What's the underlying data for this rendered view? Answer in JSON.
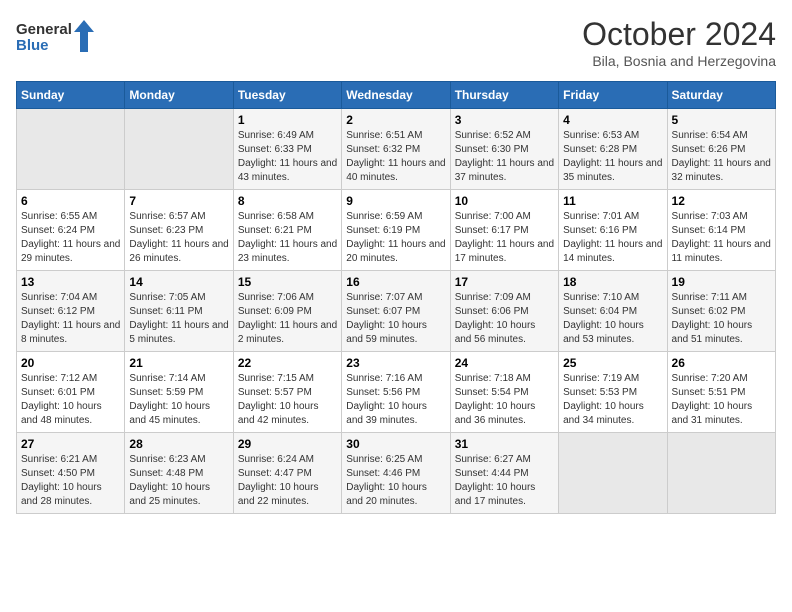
{
  "header": {
    "logo_line1": "General",
    "logo_line2": "Blue",
    "month": "October 2024",
    "location": "Bila, Bosnia and Herzegovina"
  },
  "weekdays": [
    "Sunday",
    "Monday",
    "Tuesday",
    "Wednesday",
    "Thursday",
    "Friday",
    "Saturday"
  ],
  "weeks": [
    [
      {
        "num": "",
        "info": ""
      },
      {
        "num": "",
        "info": ""
      },
      {
        "num": "1",
        "info": "Sunrise: 6:49 AM\nSunset: 6:33 PM\nDaylight: 11 hours and 43 minutes."
      },
      {
        "num": "2",
        "info": "Sunrise: 6:51 AM\nSunset: 6:32 PM\nDaylight: 11 hours and 40 minutes."
      },
      {
        "num": "3",
        "info": "Sunrise: 6:52 AM\nSunset: 6:30 PM\nDaylight: 11 hours and 37 minutes."
      },
      {
        "num": "4",
        "info": "Sunrise: 6:53 AM\nSunset: 6:28 PM\nDaylight: 11 hours and 35 minutes."
      },
      {
        "num": "5",
        "info": "Sunrise: 6:54 AM\nSunset: 6:26 PM\nDaylight: 11 hours and 32 minutes."
      }
    ],
    [
      {
        "num": "6",
        "info": "Sunrise: 6:55 AM\nSunset: 6:24 PM\nDaylight: 11 hours and 29 minutes."
      },
      {
        "num": "7",
        "info": "Sunrise: 6:57 AM\nSunset: 6:23 PM\nDaylight: 11 hours and 26 minutes."
      },
      {
        "num": "8",
        "info": "Sunrise: 6:58 AM\nSunset: 6:21 PM\nDaylight: 11 hours and 23 minutes."
      },
      {
        "num": "9",
        "info": "Sunrise: 6:59 AM\nSunset: 6:19 PM\nDaylight: 11 hours and 20 minutes."
      },
      {
        "num": "10",
        "info": "Sunrise: 7:00 AM\nSunset: 6:17 PM\nDaylight: 11 hours and 17 minutes."
      },
      {
        "num": "11",
        "info": "Sunrise: 7:01 AM\nSunset: 6:16 PM\nDaylight: 11 hours and 14 minutes."
      },
      {
        "num": "12",
        "info": "Sunrise: 7:03 AM\nSunset: 6:14 PM\nDaylight: 11 hours and 11 minutes."
      }
    ],
    [
      {
        "num": "13",
        "info": "Sunrise: 7:04 AM\nSunset: 6:12 PM\nDaylight: 11 hours and 8 minutes."
      },
      {
        "num": "14",
        "info": "Sunrise: 7:05 AM\nSunset: 6:11 PM\nDaylight: 11 hours and 5 minutes."
      },
      {
        "num": "15",
        "info": "Sunrise: 7:06 AM\nSunset: 6:09 PM\nDaylight: 11 hours and 2 minutes."
      },
      {
        "num": "16",
        "info": "Sunrise: 7:07 AM\nSunset: 6:07 PM\nDaylight: 10 hours and 59 minutes."
      },
      {
        "num": "17",
        "info": "Sunrise: 7:09 AM\nSunset: 6:06 PM\nDaylight: 10 hours and 56 minutes."
      },
      {
        "num": "18",
        "info": "Sunrise: 7:10 AM\nSunset: 6:04 PM\nDaylight: 10 hours and 53 minutes."
      },
      {
        "num": "19",
        "info": "Sunrise: 7:11 AM\nSunset: 6:02 PM\nDaylight: 10 hours and 51 minutes."
      }
    ],
    [
      {
        "num": "20",
        "info": "Sunrise: 7:12 AM\nSunset: 6:01 PM\nDaylight: 10 hours and 48 minutes."
      },
      {
        "num": "21",
        "info": "Sunrise: 7:14 AM\nSunset: 5:59 PM\nDaylight: 10 hours and 45 minutes."
      },
      {
        "num": "22",
        "info": "Sunrise: 7:15 AM\nSunset: 5:57 PM\nDaylight: 10 hours and 42 minutes."
      },
      {
        "num": "23",
        "info": "Sunrise: 7:16 AM\nSunset: 5:56 PM\nDaylight: 10 hours and 39 minutes."
      },
      {
        "num": "24",
        "info": "Sunrise: 7:18 AM\nSunset: 5:54 PM\nDaylight: 10 hours and 36 minutes."
      },
      {
        "num": "25",
        "info": "Sunrise: 7:19 AM\nSunset: 5:53 PM\nDaylight: 10 hours and 34 minutes."
      },
      {
        "num": "26",
        "info": "Sunrise: 7:20 AM\nSunset: 5:51 PM\nDaylight: 10 hours and 31 minutes."
      }
    ],
    [
      {
        "num": "27",
        "info": "Sunrise: 6:21 AM\nSunset: 4:50 PM\nDaylight: 10 hours and 28 minutes."
      },
      {
        "num": "28",
        "info": "Sunrise: 6:23 AM\nSunset: 4:48 PM\nDaylight: 10 hours and 25 minutes."
      },
      {
        "num": "29",
        "info": "Sunrise: 6:24 AM\nSunset: 4:47 PM\nDaylight: 10 hours and 22 minutes."
      },
      {
        "num": "30",
        "info": "Sunrise: 6:25 AM\nSunset: 4:46 PM\nDaylight: 10 hours and 20 minutes."
      },
      {
        "num": "31",
        "info": "Sunrise: 6:27 AM\nSunset: 4:44 PM\nDaylight: 10 hours and 17 minutes."
      },
      {
        "num": "",
        "info": ""
      },
      {
        "num": "",
        "info": ""
      }
    ]
  ]
}
